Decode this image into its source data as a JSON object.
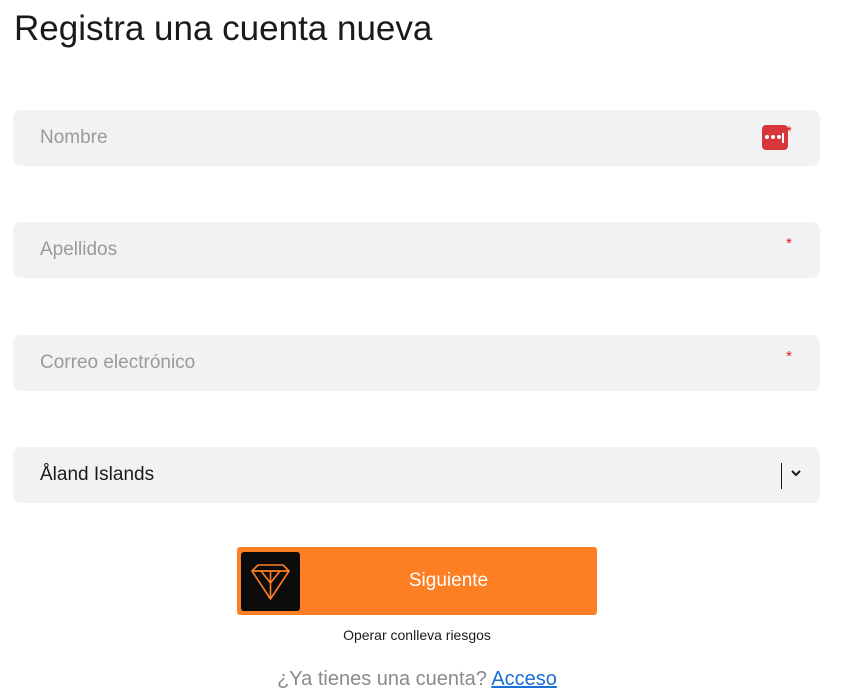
{
  "form": {
    "title": "Registra una cuenta nueva",
    "first_name": {
      "placeholder": "Nombre",
      "value": "",
      "required_mark": "*"
    },
    "last_name": {
      "placeholder": "Apellidos",
      "value": "",
      "required_mark": "*"
    },
    "email": {
      "placeholder": "Correo electrónico",
      "value": "",
      "required_mark": "*"
    },
    "country": {
      "selected": "Åland Islands"
    },
    "next_button": {
      "label": "Siguiente"
    },
    "risk_note": "Operar conlleva riesgos",
    "login_prompt": "¿Ya tienes una cuenta?",
    "login_link": "Acceso"
  },
  "icons": {
    "password_manager": "password-manager-icon",
    "chevron": "chevron-down-icon",
    "brand": "brand-logo-icon"
  },
  "colors": {
    "accent": "#fd7e23",
    "field_bg": "#f1f2f4",
    "required": "#e02020",
    "link": "#1a6fd6",
    "badge": "#d9363a"
  }
}
